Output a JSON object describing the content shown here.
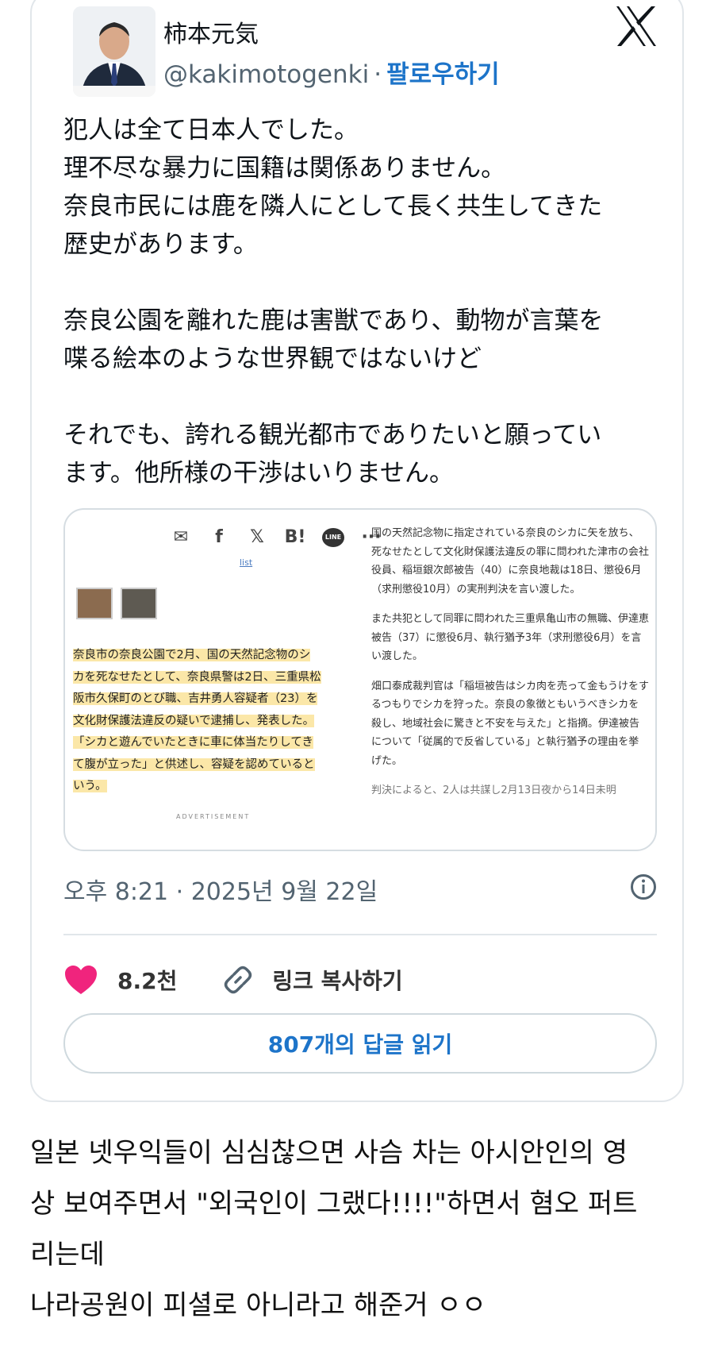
{
  "tweet": {
    "display_name": "柿本元気",
    "handle": "@kakimotogenki",
    "separator": "·",
    "follow_label": "팔로우하기",
    "lines": [
      "犯人は全て日本人でした。",
      "理不尽な暴力に国籍は関係ありません。",
      "奈良市民には鹿を隣人にとして長く共生してきた",
      "歴史があります。",
      "",
      "奈良公園を離れた鹿は害獣であり、動物が言葉を",
      "喋る絵本のような世界観ではないけど",
      "",
      "それでも、誇れる観光都市でありたいと願ってい",
      "ます。他所様の干渉はいりません。"
    ],
    "timestamp": "오후 8:21 · 2025년 9월 22일",
    "likes": "8.2천",
    "copy_link_label": "링크 복사하기",
    "replies_label": "807개의 답글 읽기"
  },
  "media": {
    "share_icons": [
      "mail-icon",
      "facebook-icon",
      "x-icon",
      "hatena-icon",
      "line-icon",
      "more-icon"
    ],
    "share_glyphs": [
      "✉",
      "f",
      "𝕏",
      "B!",
      "LINE",
      "···"
    ],
    "list_link": "list",
    "highlighted_lines": [
      "奈良市の奈良公園で2月、国の天然記念物のシ",
      "カを死なせたとして、奈良県警は2日、三重県松",
      "阪市久保町のとび職、吉井勇人容疑者（23）を",
      "文化財保護法違反の疑いで逮捕し、発表した。",
      "「シカと遊んでいたときに車に体当たりしてき",
      "て腹が立った」と供述し、容疑を認めていると",
      "いう。"
    ],
    "advertisement": "ADVERTISEMENT",
    "article_paragraphs": [
      "国の天然記念物に指定されている奈良のシカに矢を放ち、死なせたとして文化財保護法違反の罪に問われた津市の会社役員、稲垣銀次郎被告（40）に奈良地裁は18日、懲役6月（求刑懲役10月）の実刑判決を言い渡した。",
      "また共犯として同罪に問われた三重県亀山市の無職、伊達恵被告（37）に懲役6月、執行猶予3年（求刑懲役6月）を言い渡した。",
      "畑口泰成裁判官は「稲垣被告はシカ肉を売って金もうけをするつもりでシカを狩った。奈良の象徴ともいうべきシカを殺し、地域社会に驚きと不安を与えた」と指摘。伊達被告について「従属的で反省している」と執行猶予の理由を挙げた。",
      "判決によると、2人は共謀し2月13日夜から14日未明"
    ]
  },
  "comment": {
    "lines": [
      "일본 넷우익들이 심심찮으면 사슴 차는 아시안인의 영",
      "상 보여주면서 \"외국인이 그랬다!!!!\"하면서 혐오 퍼트",
      "리는데",
      "나라공원이 피셜로 아니라고 해준거 ㅇㅇ"
    ]
  },
  "colors": {
    "accent_blue": "#1d74c9",
    "heart_pink": "#f0247d",
    "highlight": "#fbe7a8",
    "muted": "#536471"
  }
}
